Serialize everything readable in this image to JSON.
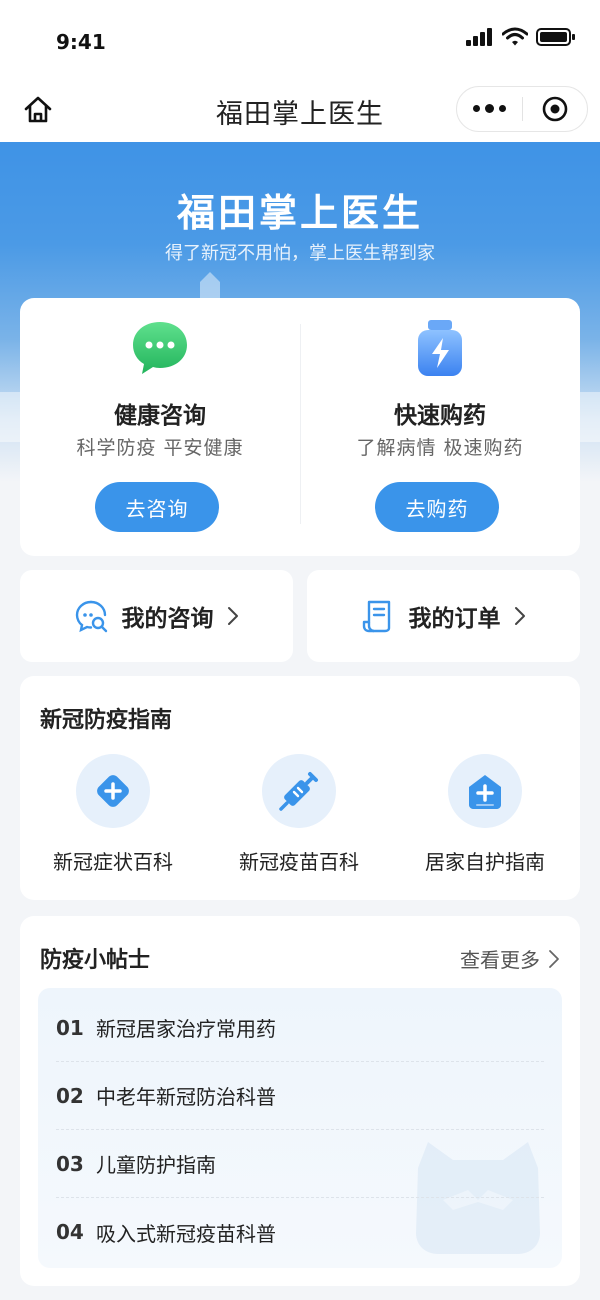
{
  "status_bar": {
    "time": "9:41"
  },
  "nav": {
    "title": "福田掌上医生"
  },
  "hero": {
    "title": "福田掌上医生",
    "subtitle": "得了新冠不用怕，掌上医生帮到家"
  },
  "services": [
    {
      "title": "健康咨询",
      "desc": "科学防疫 平安健康",
      "button": "去咨询",
      "icon": "chat-bubble-icon",
      "color": "#2fc56a"
    },
    {
      "title": "快速购药",
      "desc": "了解病情 极速购药",
      "button": "去购药",
      "icon": "medicine-bottle-icon",
      "color": "#4a8ff0"
    }
  ],
  "quick_links": [
    {
      "label": "我的咨询",
      "icon": "consult-chat-icon"
    },
    {
      "label": "我的订单",
      "icon": "order-list-icon"
    }
  ],
  "guide": {
    "title": "新冠防疫指南",
    "items": [
      {
        "label": "新冠症状百科",
        "icon": "medical-kit-icon"
      },
      {
        "label": "新冠疫苗百科",
        "icon": "syringe-icon"
      },
      {
        "label": "居家自护指南",
        "icon": "home-care-icon"
      }
    ]
  },
  "tips": {
    "title": "防疫小帖士",
    "more": "查看更多",
    "items": [
      {
        "num": "01",
        "text": "新冠居家治疗常用药"
      },
      {
        "num": "02",
        "text": "中老年新冠防治科普"
      },
      {
        "num": "03",
        "text": "儿童防护指南"
      },
      {
        "num": "04",
        "text": "吸入式新冠疫苗科普"
      }
    ]
  },
  "colors": {
    "accent": "#3a94ea",
    "hero": "#3f93e6",
    "background": "#f3f5f8"
  }
}
